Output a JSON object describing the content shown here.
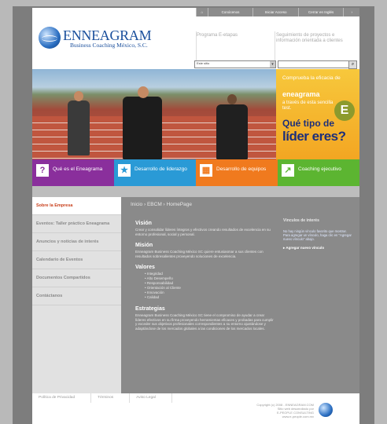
{
  "topbar": {
    "home_icon": "home-icon",
    "items": [
      "Conócenos",
      "Iniciar Acceso",
      "Cerrar en Inglés"
    ],
    "last_icon": "chevron-icon"
  },
  "logo": {
    "name": "ENNEAGRAM",
    "subtitle": "Business Coaching México, S.C."
  },
  "header_links": {
    "program": "Programa E-etapas",
    "tracking": "Seguimiento de proyectos e información orientada a clientes"
  },
  "site_select": {
    "value": "Este sitio"
  },
  "promo": {
    "line1": "Comprueba la eficacia de",
    "brand": "eneagrama",
    "line2": "a través de esta sencilla test.",
    "q1": "Qué tipo de",
    "q2": "líder eres?",
    "letter": "E"
  },
  "tiles": [
    {
      "label": "Qué es el Eneagrama",
      "icon": "?",
      "color": "#8a2f9c"
    },
    {
      "label": "Desarrollo de liderazgo",
      "icon": "★",
      "color": "#2a9ad6"
    },
    {
      "label": "Desarrollo de equipos",
      "icon": "▦",
      "color": "#f07a1e"
    },
    {
      "label": "Coaching ejecutivo",
      "icon": "↗",
      "color": "#5cb531"
    }
  ],
  "sidebar": {
    "items": [
      "Sobre la Empresa",
      "Eventos: Taller práctico Eneagrama",
      "Anuncios y noticias de interés",
      "Calendario de Eventos",
      "Documentos Compartidos",
      "Contáctanos"
    ]
  },
  "breadcrumb": "Inicio  ›  EBCM  ›  HomePage",
  "content": {
    "vision_title": "Visión",
    "vision_text": "Crear y consolidar líderes íntegros y efectivos creando resultados de excelencia en su entorno profesional, social y personal.",
    "mision_title": "Misión",
    "mision_text": "Enneagram Business Coaching México SC quiere entusiasmar a sus clientes con resultados sobresalientes proveyendo soluciones de excelencia.",
    "valores_title": "Valores",
    "valores": [
      "Integridad",
      "Alto Desempeño",
      "Responsabilidad",
      "Orientación al Cliente",
      "Innovación",
      "Calidad"
    ],
    "estrategias_title": "Estrategias",
    "estrategias_text": "Enneagram Business Coaching México SC tiene el compromiso de ayudar a crear líderes efectivos en su firma proveyendo herramientas eficaces y probadas para cumplir y exceder sus objetivos profesionales correspondientes a su entorno ajustándose y adaptándose de los mercados globales a las condiciones de los mercados locales."
  },
  "right_panel": {
    "title": "Vínculos de interés",
    "body": "No hay ningún vínculo favorito que mostrar. Para agregar un vínculo, haga clic en \"Agregar nuevo vínculo\" abajo.",
    "add_link": "Agregar nuevo vínculo"
  },
  "footer": {
    "nav": [
      "Política de Privacidad",
      "Términos",
      "Aviso Legal"
    ],
    "copyright": "Copyright (c) 2008 - ENNEAGRAM.COM",
    "line2": "Sitio web desarrollado por",
    "line3": "E-PEOPLE CONSULTING",
    "line4": "www.e-people.com.mx"
  }
}
